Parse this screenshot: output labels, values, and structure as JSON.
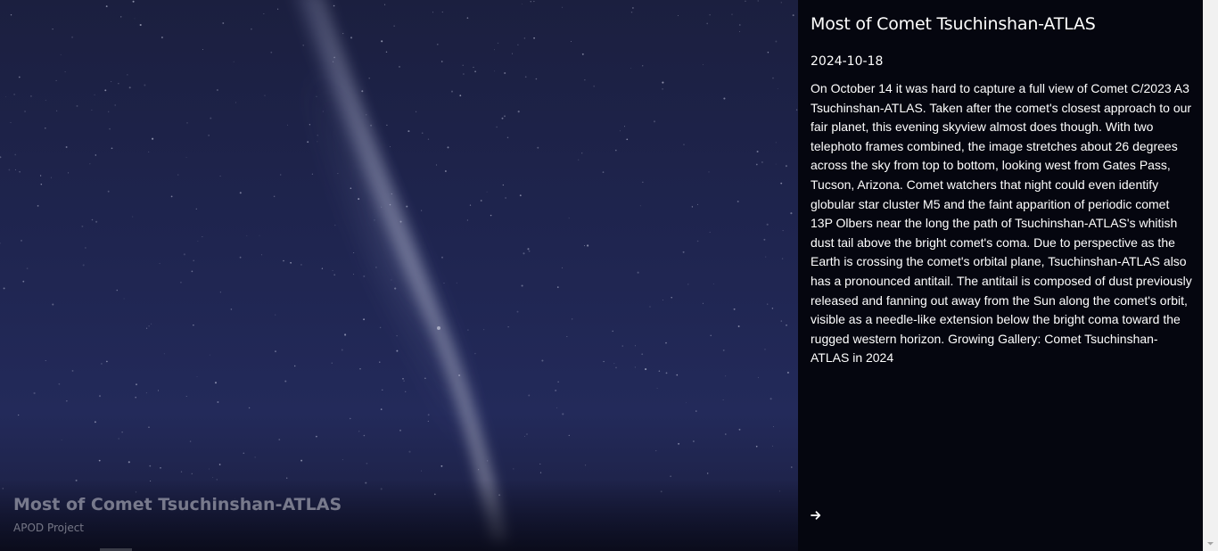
{
  "image": {
    "caption_title": "Most of Comet Tsuchinshan-ATLAS",
    "caption_credit": "APOD Project"
  },
  "info": {
    "title": "Most of Comet Tsuchinshan-ATLAS",
    "date": "2024-10-18",
    "explanation": "On October 14 it was hard to capture a full view of Comet C/2023 A3 Tsuchinshan-ATLAS. Taken after the comet's closest approach to our fair planet, this evening skyview almost does though. With two telephoto frames combined, the image stretches about 26 degrees across the sky from top to bottom, looking west from Gates Pass, Tucson, Arizona. Comet watchers that night could even identify globular star cluster M5 and the faint apparition of periodic comet 13P Olbers near the long the path of Tsuchinshan-ATLAS's whitish dust tail above the bright comet's coma. Due to perspective as the Earth is crossing the comet's orbital plane, Tsuchinshan-ATLAS also has a pronounced antitail. The antitail is composed of dust previously released and fanning out away from the Sun along the comet's orbit, visible as a needle-like extension below the bright coma toward the rugged western horizon. Growing Gallery: Comet Tsuchinshan-ATLAS in 2024",
    "next_icon": "arrow-right-icon"
  },
  "colors": {
    "panel_background": "#05060f",
    "sky_blue": "#1f2550",
    "text": "#ffffff"
  }
}
